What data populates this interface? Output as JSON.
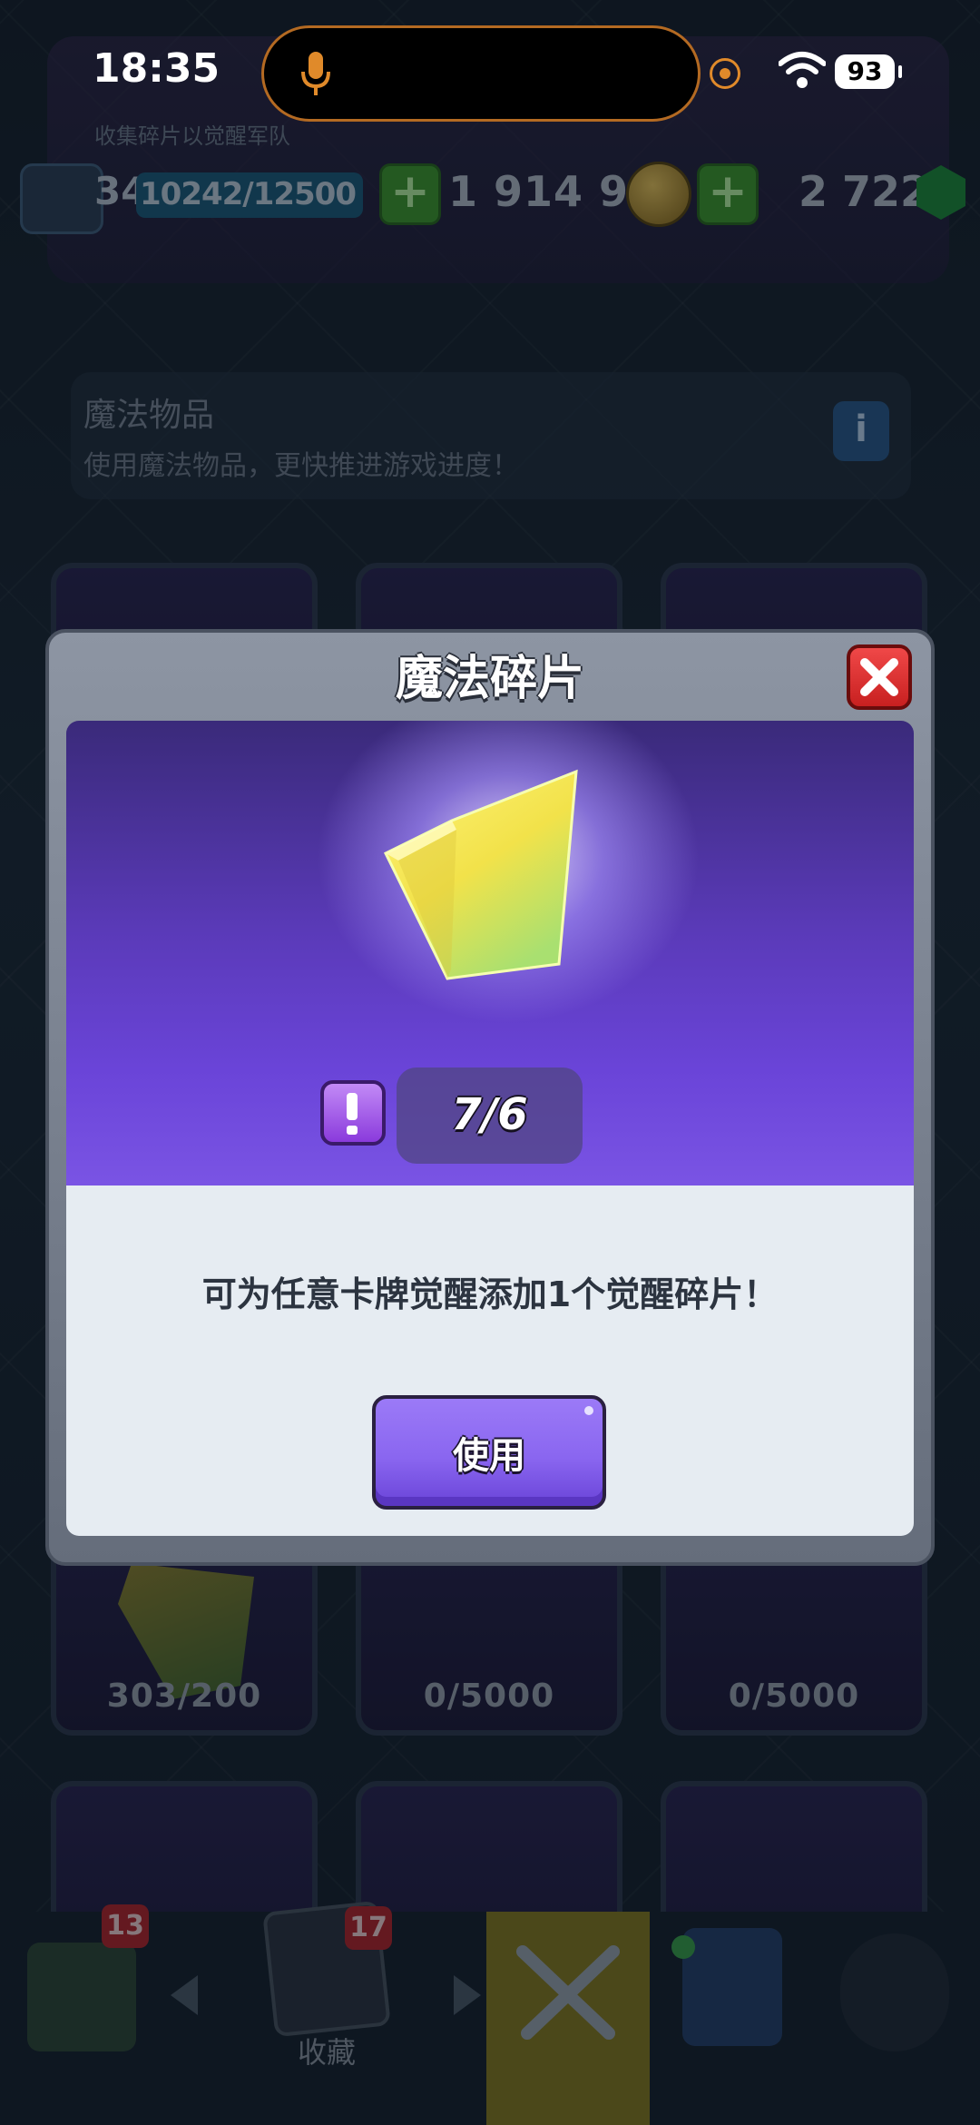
{
  "status_bar": {
    "time": "18:35",
    "battery": "93"
  },
  "header": {
    "subtitle": "收集碎片以觉醒军队",
    "level": "34",
    "xp": "10242/12500",
    "gold": "1 914 969",
    "gems": "2 722"
  },
  "magic_items": {
    "title": "魔法物品",
    "description": "使用魔法物品，更快推进游戏进度！"
  },
  "grid": {
    "cards": [
      {
        "count": "303/200"
      },
      {
        "count": "0/5000"
      },
      {
        "count": "0/5000"
      }
    ]
  },
  "bottom_nav": {
    "shop_badge": "13",
    "collection_badge": "17",
    "collection_label": "收藏"
  },
  "modal": {
    "title": "魔法碎片",
    "count": "7/6",
    "description": "可为任意卡牌觉醒添加1个觉醒碎片！",
    "use_label": "使用"
  },
  "colors": {
    "accent_purple": "#8a66f0",
    "close_red": "#d82a2a",
    "shard_yellow": "#f4e04a"
  }
}
